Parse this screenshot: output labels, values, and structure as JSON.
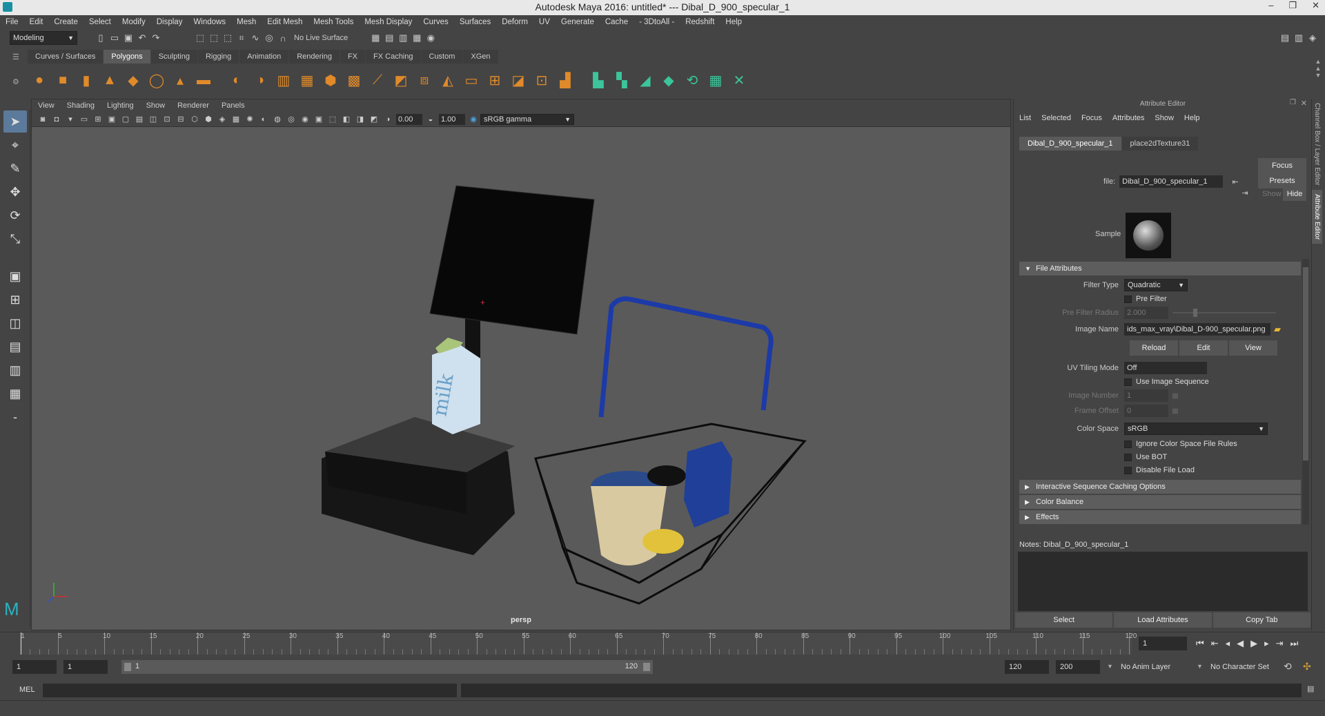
{
  "window": {
    "title": "Autodesk Maya 2016: untitled*   ---   Dibal_D_900_specular_1",
    "controls": [
      "–",
      "❐",
      "✕"
    ]
  },
  "menubar": [
    "File",
    "Edit",
    "Create",
    "Select",
    "Modify",
    "Display",
    "Windows",
    "Mesh",
    "Edit Mesh",
    "Mesh Tools",
    "Mesh Display",
    "Curves",
    "Surfaces",
    "Deform",
    "UV",
    "Generate",
    "Cache",
    "- 3DtoAll -",
    "Redshift",
    "Help"
  ],
  "statusline": {
    "mode": "Modeling",
    "live_surface": "No Live Surface"
  },
  "shelf": {
    "tabs": [
      "Curves / Surfaces",
      "Polygons",
      "Sculpting",
      "Rigging",
      "Animation",
      "Rendering",
      "FX",
      "FX Caching",
      "Custom",
      "XGen"
    ],
    "active": "Polygons"
  },
  "viewport": {
    "menu": [
      "View",
      "Shading",
      "Lighting",
      "Show",
      "Renderer",
      "Panels"
    ],
    "exposure": "0.00",
    "gamma": "1.00",
    "color_space": "sRGB gamma",
    "camera_label": "persp"
  },
  "attr_editor": {
    "panel_title": "Attribute Editor",
    "menu": [
      "List",
      "Selected",
      "Focus",
      "Attributes",
      "Show",
      "Help"
    ],
    "tabs": [
      "Dibal_D_900_specular_1",
      "place2dTexture31"
    ],
    "file_label": "file:",
    "file_value": "Dibal_D_900_specular_1",
    "focus_btn": "Focus",
    "presets_btn": "Presets",
    "show_label": "Show",
    "hide_btn": "Hide",
    "sample_label": "Sample",
    "section_file": "File Attributes",
    "filter_type_label": "Filter Type",
    "filter_type_value": "Quadratic",
    "pre_filter": "Pre Filter",
    "pre_filter_radius_label": "Pre Filter Radius",
    "pre_filter_radius_value": "2.000",
    "image_name_label": "Image Name",
    "image_name_value": "ids_max_vray\\Dibal_D-900_specular.png",
    "reload_btn": "Reload",
    "edit_btn": "Edit",
    "view_btn": "View",
    "uv_tiling_label": "UV Tiling Mode",
    "uv_tiling_value": "Off",
    "use_image_seq": "Use Image Sequence",
    "image_number_label": "Image Number",
    "image_number_value": "1",
    "frame_offset_label": "Frame Offset",
    "frame_offset_value": "0",
    "color_space_label": "Color Space",
    "color_space_value": "sRGB",
    "ignore_cs": "Ignore Color Space File Rules",
    "use_bot": "Use BOT",
    "disable_load": "Disable File Load",
    "section_interactive": "Interactive Sequence Caching Options",
    "section_color_balance": "Color Balance",
    "section_effects": "Effects",
    "notes": "Notes:  Dibal_D_900_specular_1",
    "select_btn": "Select",
    "load_attr_btn": "Load Attributes",
    "copy_tab_btn": "Copy Tab"
  },
  "side_tabs": [
    "Channel Box / Layer Editor",
    "Attribute Editor"
  ],
  "timeline": {
    "ticks": [
      5,
      10,
      15,
      20,
      25,
      30,
      35,
      40,
      45,
      50,
      55,
      60,
      65,
      70,
      75,
      80,
      85,
      90,
      95,
      100,
      105,
      110,
      115,
      120
    ],
    "first_tick": "1",
    "current_frame": "1",
    "min": 1,
    "max": 120
  },
  "range": {
    "start": "1",
    "playback_start": "1",
    "slider_start": "1",
    "slider_end": "120",
    "end": "120",
    "anim_end": "200",
    "anim_layer": "No Anim Layer",
    "char_set": "No Character Set"
  },
  "command_line": {
    "label": "MEL"
  },
  "colors": {
    "selected_tab": "#5a5a5a",
    "basket_handle": "#1c3aa8",
    "tool_selected": "#5c7a9b"
  }
}
